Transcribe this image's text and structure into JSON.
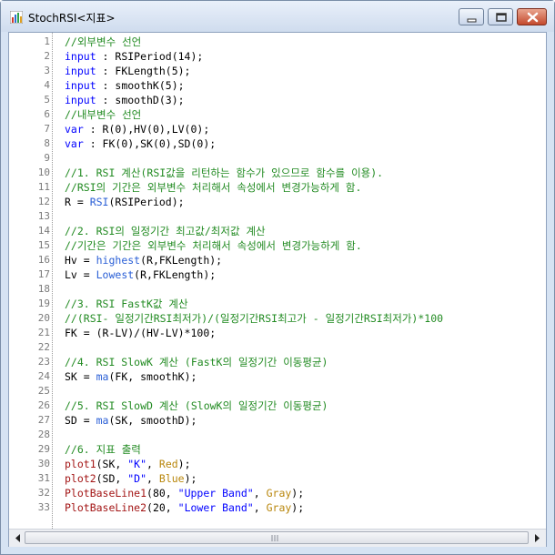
{
  "window": {
    "title": "StochRSI<지표>",
    "icon": "bar-chart-icon",
    "buttons": [
      "minimize-icon",
      "maximize-icon",
      "close-icon"
    ]
  },
  "colors": {
    "comment": "#228b22",
    "keyword": "#0000ff",
    "function": "#2a5fd6",
    "string": "#a31515",
    "plotcolor": "#b8860b",
    "plain": "#000000",
    "line_number": "#7a7a7a"
  },
  "editor": {
    "lines": [
      {
        "n": "1",
        "tokens": [
          {
            "t": "//외부변수 선언",
            "c": "comment"
          }
        ]
      },
      {
        "n": "2",
        "tokens": [
          {
            "t": "input",
            "c": "keyword"
          },
          {
            "t": " : RSIPeriod(14);",
            "c": "plain"
          }
        ]
      },
      {
        "n": "3",
        "tokens": [
          {
            "t": "input",
            "c": "keyword"
          },
          {
            "t": " : FKLength(5);",
            "c": "plain"
          }
        ]
      },
      {
        "n": "4",
        "tokens": [
          {
            "t": "input",
            "c": "keyword"
          },
          {
            "t": " : smoothK(5);",
            "c": "plain"
          }
        ]
      },
      {
        "n": "5",
        "tokens": [
          {
            "t": "input",
            "c": "keyword"
          },
          {
            "t": " : smoothD(3);",
            "c": "plain"
          }
        ]
      },
      {
        "n": "6",
        "tokens": [
          {
            "t": "//내부변수 선언",
            "c": "comment"
          }
        ]
      },
      {
        "n": "7",
        "tokens": [
          {
            "t": "var",
            "c": "keyword"
          },
          {
            "t": " : R(0),HV(0),LV(0);",
            "c": "plain"
          }
        ]
      },
      {
        "n": "8",
        "tokens": [
          {
            "t": "var",
            "c": "keyword"
          },
          {
            "t": " : FK(0),SK(0),SD(0);",
            "c": "plain"
          }
        ]
      },
      {
        "n": "9",
        "tokens": []
      },
      {
        "n": "10",
        "tokens": [
          {
            "t": "//1. RSI 계산(RSI값을 리턴하는 함수가 있으므로 함수를 이용).",
            "c": "comment"
          }
        ]
      },
      {
        "n": "11",
        "tokens": [
          {
            "t": "//RSI의 기간은 외부변수 처리해서 속성에서 변경가능하게 함.",
            "c": "comment"
          }
        ]
      },
      {
        "n": "12",
        "tokens": [
          {
            "t": "R = ",
            "c": "plain"
          },
          {
            "t": "RSI",
            "c": "function"
          },
          {
            "t": "(RSIPeriod);",
            "c": "plain"
          }
        ]
      },
      {
        "n": "13",
        "tokens": []
      },
      {
        "n": "14",
        "tokens": [
          {
            "t": "//2. RSI의 일정기간 최고값/최저값 계산",
            "c": "comment"
          }
        ]
      },
      {
        "n": "15",
        "tokens": [
          {
            "t": "//기간은 기간은 외부변수 처리해서 속성에서 변경가능하게 함.",
            "c": "comment"
          }
        ]
      },
      {
        "n": "16",
        "tokens": [
          {
            "t": "Hv = ",
            "c": "plain"
          },
          {
            "t": "highest",
            "c": "function"
          },
          {
            "t": "(R,FKLength);",
            "c": "plain"
          }
        ]
      },
      {
        "n": "17",
        "tokens": [
          {
            "t": "Lv = ",
            "c": "plain"
          },
          {
            "t": "Lowest",
            "c": "function"
          },
          {
            "t": "(R,FKLength);",
            "c": "plain"
          }
        ]
      },
      {
        "n": "18",
        "tokens": []
      },
      {
        "n": "19",
        "tokens": [
          {
            "t": "//3. RSI FastK값 계산",
            "c": "comment"
          }
        ]
      },
      {
        "n": "20",
        "tokens": [
          {
            "t": "//(RSI- 일정기간RSI최저가)/(일정기간RSI최고가 - 일정기간RSI최저가)*100",
            "c": "comment"
          }
        ]
      },
      {
        "n": "21",
        "tokens": [
          {
            "t": "FK = (R-LV)/(HV-LV)*100;",
            "c": "plain"
          }
        ]
      },
      {
        "n": "22",
        "tokens": []
      },
      {
        "n": "23",
        "tokens": [
          {
            "t": "//4. RSI SlowK 계산 (FastK의 일정기간 이동평균)",
            "c": "comment"
          }
        ]
      },
      {
        "n": "24",
        "tokens": [
          {
            "t": "SK = ",
            "c": "plain"
          },
          {
            "t": "ma",
            "c": "function"
          },
          {
            "t": "(FK, smoothK);",
            "c": "plain"
          }
        ]
      },
      {
        "n": "25",
        "tokens": []
      },
      {
        "n": "26",
        "tokens": [
          {
            "t": "//5. RSI SlowD 계산 (SlowK의 일정기간 이동평균)",
            "c": "comment"
          }
        ]
      },
      {
        "n": "27",
        "tokens": [
          {
            "t": "SD = ",
            "c": "plain"
          },
          {
            "t": "ma",
            "c": "function"
          },
          {
            "t": "(SK, smoothD);",
            "c": "plain"
          }
        ]
      },
      {
        "n": "28",
        "tokens": []
      },
      {
        "n": "29",
        "tokens": [
          {
            "t": "//6. 지표 출력",
            "c": "comment"
          }
        ]
      },
      {
        "n": "30",
        "tokens": [
          {
            "t": "plot1",
            "c": "string"
          },
          {
            "t": "(SK, ",
            "c": "plain"
          },
          {
            "t": "\"K\"",
            "c": "keyword"
          },
          {
            "t": ", ",
            "c": "plain"
          },
          {
            "t": "Red",
            "c": "plotcolor"
          },
          {
            "t": ");",
            "c": "plain"
          }
        ]
      },
      {
        "n": "31",
        "tokens": [
          {
            "t": "plot2",
            "c": "string"
          },
          {
            "t": "(SD, ",
            "c": "plain"
          },
          {
            "t": "\"D\"",
            "c": "keyword"
          },
          {
            "t": ", ",
            "c": "plain"
          },
          {
            "t": "Blue",
            "c": "plotcolor"
          },
          {
            "t": ");",
            "c": "plain"
          }
        ]
      },
      {
        "n": "32",
        "tokens": [
          {
            "t": "PlotBaseLine1",
            "c": "string"
          },
          {
            "t": "(80, ",
            "c": "plain"
          },
          {
            "t": "\"Upper Band\"",
            "c": "keyword"
          },
          {
            "t": ", ",
            "c": "plain"
          },
          {
            "t": "Gray",
            "c": "plotcolor"
          },
          {
            "t": ");",
            "c": "plain"
          }
        ]
      },
      {
        "n": "33",
        "tokens": [
          {
            "t": "PlotBaseLine2",
            "c": "string"
          },
          {
            "t": "(20, ",
            "c": "plain"
          },
          {
            "t": "\"Lower Band\"",
            "c": "keyword"
          },
          {
            "t": ", ",
            "c": "plain"
          },
          {
            "t": "Gray",
            "c": "plotcolor"
          },
          {
            "t": ");",
            "c": "plain"
          }
        ]
      }
    ]
  },
  "scrollbar": {
    "left_icon": "arrow-left-icon",
    "right_icon": "arrow-right-icon",
    "grip_icon": "grip-icon"
  }
}
